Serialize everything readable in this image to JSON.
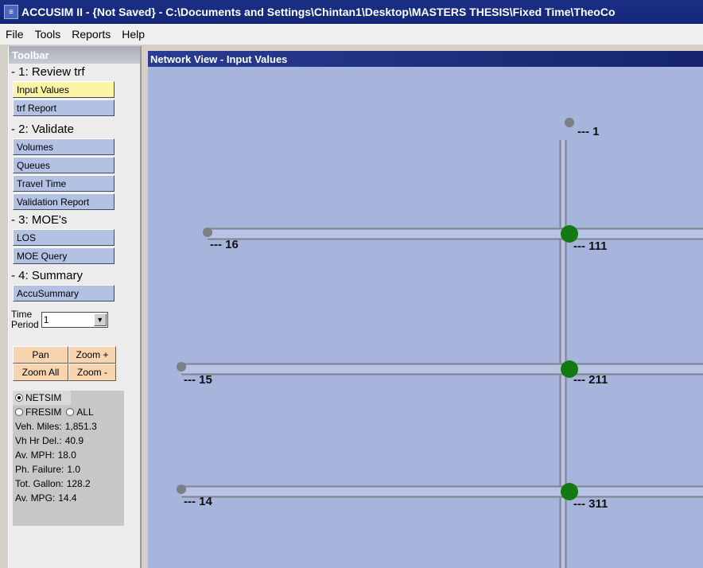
{
  "window": {
    "title": "ACCUSIM II - {Not Saved} - C:\\Documents and Settings\\Chintan1\\Desktop\\MASTERS THESIS\\Fixed Time\\TheoCo",
    "app_icon": "accusim-app-icon"
  },
  "menu": [
    "File",
    "Tools",
    "Reports",
    "Help"
  ],
  "toolbar": {
    "title": "Toolbar",
    "sections": [
      {
        "label": "- 1: Review trf",
        "buttons": [
          "Input Values",
          "trf Report"
        ]
      },
      {
        "label": "- 2: Validate",
        "buttons": [
          "Volumes",
          "Queues",
          "Travel Time",
          "Validation Report"
        ]
      },
      {
        "label": "- 3: MOE's",
        "buttons": [
          "LOS",
          "MOE Query"
        ]
      },
      {
        "label": "- 4: Summary",
        "buttons": [
          "AccuSummary"
        ]
      }
    ],
    "active_button": "Input Values",
    "time_period_label_1": "Time",
    "time_period_label_2": "Period",
    "time_period_value": "1",
    "nav_buttons": [
      "Pan",
      "Zoom +",
      "Zoom All",
      "Zoom -"
    ],
    "radio_netsim": "NETSIM",
    "radio_fresim": "FRESIM",
    "radio_all": "ALL",
    "selected_radio": "NETSIM",
    "stats": [
      {
        "label": "Veh. Miles:",
        "value": "1,851.3"
      },
      {
        "label": "Vh Hr Del.:",
        "value": "40.9"
      },
      {
        "label": "Av. MPH:",
        "value": "18.0"
      },
      {
        "label": "Ph. Failure:",
        "value": "1.0"
      },
      {
        "label": "Tot. Gallon:",
        "value": "128.2"
      },
      {
        "label": "Av. MPG:",
        "value": "14.4"
      }
    ]
  },
  "network_view": {
    "title": "Network View - Input Values",
    "nodes": [
      {
        "label": "--- 1",
        "kind": "endpoint"
      },
      {
        "label": "--- 16",
        "kind": "endpoint"
      },
      {
        "label": "--- 111",
        "kind": "signal"
      },
      {
        "label": "--- 15",
        "kind": "endpoint"
      },
      {
        "label": "--- 211",
        "kind": "signal"
      },
      {
        "label": "--- 14",
        "kind": "endpoint"
      },
      {
        "label": "--- 311",
        "kind": "signal"
      }
    ],
    "colors": {
      "background": "#a7b5dc",
      "link": "#8a8f9a",
      "signal_node": "#137a13",
      "endpoint_node": "#7b7f86"
    }
  }
}
